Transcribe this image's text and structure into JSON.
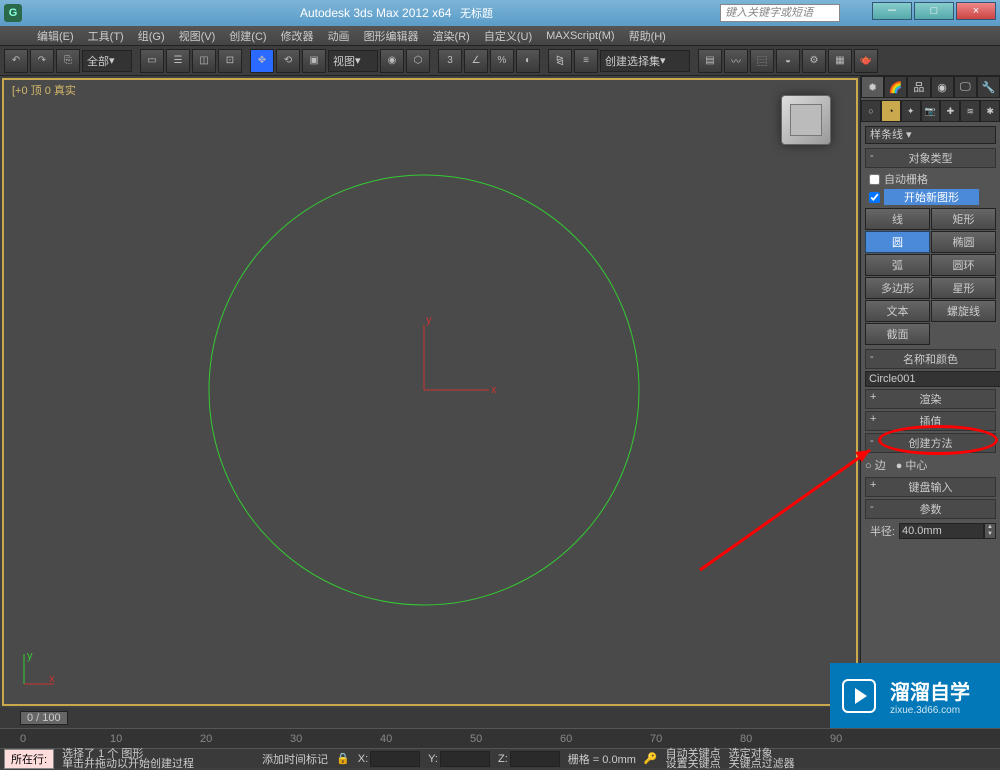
{
  "title": "Autodesk 3ds Max 2012 x64",
  "untitled": "无标题",
  "search_placeholder": "键入关键字或短语",
  "menus": [
    "编辑(E)",
    "工具(T)",
    "组(G)",
    "视图(V)",
    "创建(C)",
    "修改器",
    "动画",
    "图形编辑器",
    "渲染(R)",
    "自定义(U)",
    "MAXScript(M)",
    "帮助(H)"
  ],
  "toolbar_all": "全部",
  "toolbar_view": "视图",
  "toolbar_selset": "创建选择集",
  "viewport_label": "[+0 顶 0 真实",
  "panel": {
    "dropdown": "样条线",
    "rollout_objtype": "对象类型",
    "autogrid": "自动栅格",
    "startnew": "开始新图形",
    "buttons": [
      {
        "l": "线",
        "r": "矩形"
      },
      {
        "l": "圆",
        "r": "椭圆"
      },
      {
        "l": "弧",
        "r": "圆环"
      },
      {
        "l": "多边形",
        "r": "星形"
      },
      {
        "l": "文本",
        "r": "螺旋线"
      },
      {
        "l": "截面",
        "r": ""
      }
    ],
    "rollout_namecolor": "名称和颜色",
    "object_name": "Circle001",
    "rollout_render": "渲染",
    "rollout_interp": "插值",
    "rollout_create": "创建方法",
    "radio_edge": "边",
    "radio_center": "中心",
    "rollout_keyboard": "键盘输入",
    "rollout_params": "参数",
    "radius_label": "半径:",
    "radius_value": "40.0mm"
  },
  "time": {
    "slider": "0 / 100"
  },
  "status": {
    "selected": "选择了 1 个 图形",
    "prompt": "单击并拖动以开始创建过程",
    "addtime": "添加时间标记",
    "grid": "栅格 = 0.0mm",
    "autokey": "自动关键点",
    "selobj": "选定对象",
    "setkey": "设置关键点",
    "keyfilter": "关键点过滤器",
    "row_label": "所在行:"
  },
  "watermark": {
    "big": "溜溜自学",
    "small": "zixue.3d66.com"
  }
}
